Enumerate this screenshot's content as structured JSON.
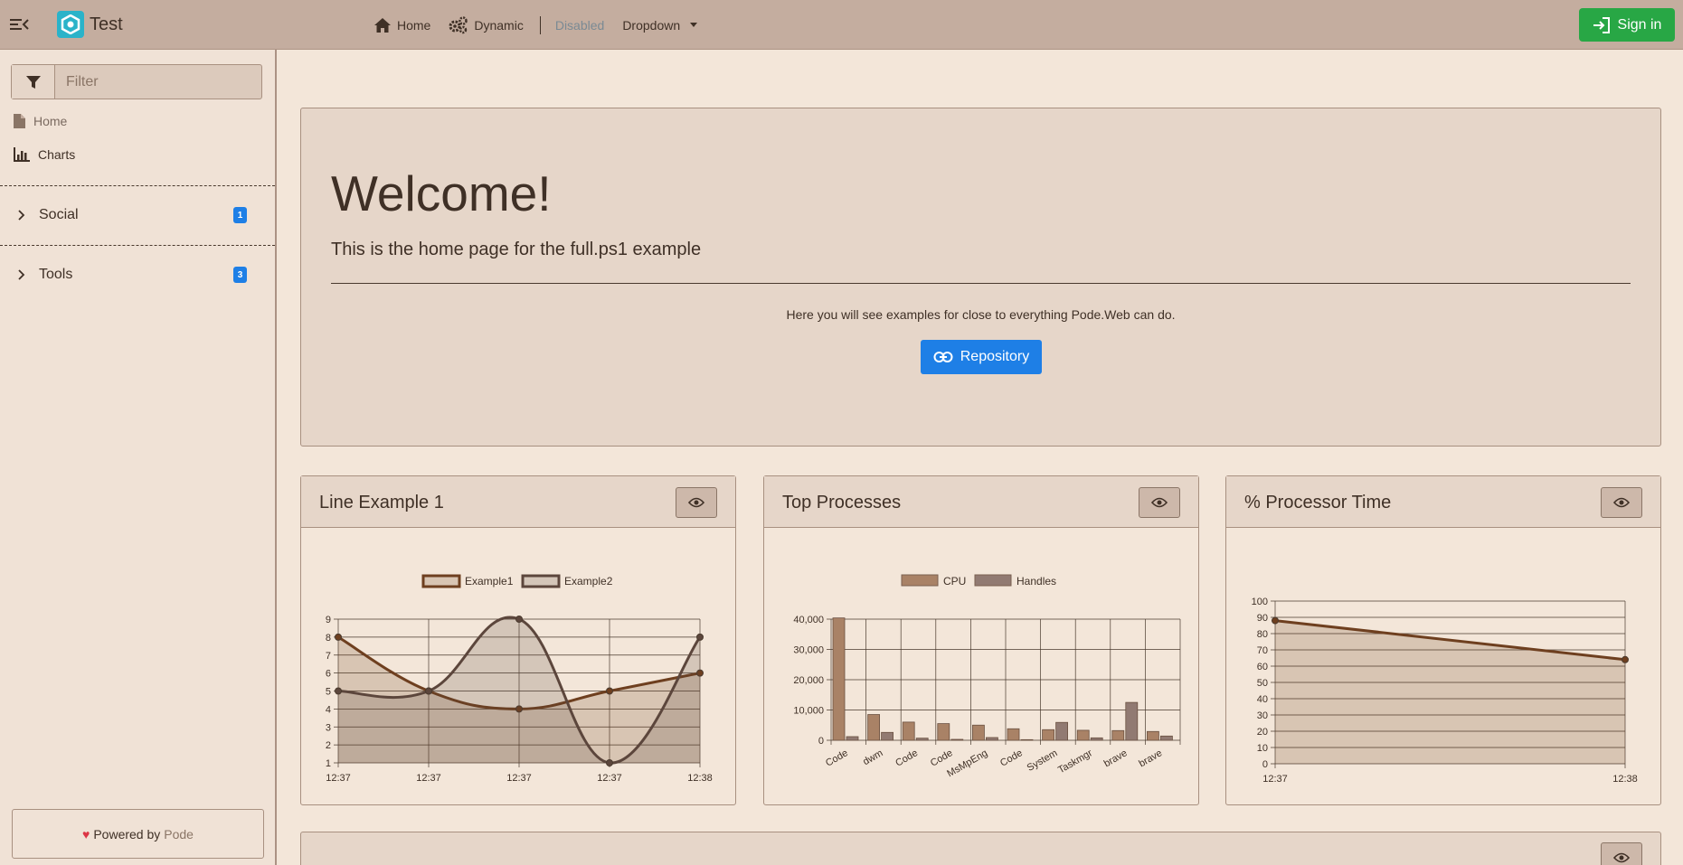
{
  "app": {
    "title": "Test",
    "brand_color": "#2ab3c9"
  },
  "nav": {
    "home": "Home",
    "dynamic": "Dynamic",
    "disabled": "Disabled",
    "dropdown": "Dropdown",
    "signin": "Sign in"
  },
  "sidebar": {
    "filter_placeholder": "Filter",
    "links": [
      {
        "label": "Home",
        "icon": "file-icon"
      },
      {
        "label": "Charts",
        "icon": "chart-bar-icon"
      }
    ],
    "groups": [
      {
        "label": "Social",
        "badge": "1"
      },
      {
        "label": "Tools",
        "badge": "3"
      }
    ],
    "powered_by": "Powered by",
    "powered_link": "Pode"
  },
  "hero": {
    "title": "Welcome!",
    "lead": "This is the home page for the full.ps1 example",
    "text": "Here you will see examples for close to everything Pode.Web can do.",
    "button": "Repository"
  },
  "cards": [
    {
      "title": "Line Example 1"
    },
    {
      "title": "Top Processes"
    },
    {
      "title": "% Processor Time"
    }
  ],
  "chart_data": [
    {
      "type": "line",
      "title": "Line Example 1",
      "x": [
        "12:37",
        "12:37",
        "12:37",
        "12:37",
        "12:38"
      ],
      "series": [
        {
          "name": "Example1",
          "values": [
            8,
            5,
            4,
            5,
            6
          ],
          "color": "#6e3f1f"
        },
        {
          "name": "Example2",
          "values": [
            5,
            5,
            9,
            1,
            8
          ],
          "color": "#5c463c"
        }
      ],
      "ylim": [
        1,
        9
      ],
      "yticks": [
        1,
        2,
        3,
        4,
        5,
        6,
        7,
        8,
        9
      ],
      "legend": "top",
      "grid": true
    },
    {
      "type": "bar",
      "title": "Top Processes",
      "categories": [
        "Code",
        "dwm",
        "Code",
        "Code",
        "MsMpEng",
        "Code",
        "System",
        "Taskmgr",
        "brave",
        "brave"
      ],
      "series": [
        {
          "name": "CPU",
          "values": [
            40500,
            8500,
            6000,
            5500,
            5000,
            3800,
            3500,
            3300,
            3200,
            2900
          ],
          "color": "#a98266"
        },
        {
          "name": "Handles",
          "values": [
            1200,
            2600,
            700,
            300,
            900,
            200,
            5900,
            800,
            12500,
            1400
          ],
          "color": "#917a72"
        }
      ],
      "ylim": [
        0,
        40000
      ],
      "yticks": [
        "0",
        "10,000",
        "20,000",
        "30,000",
        "40,000"
      ],
      "legend": "top",
      "grid": true
    },
    {
      "type": "area",
      "title": "% Processor Time",
      "x": [
        "12:37",
        "12:38"
      ],
      "series": [
        {
          "name": "",
          "values": [
            88,
            64
          ],
          "color": "#6e3f1f"
        }
      ],
      "ylim": [
        0,
        100
      ],
      "yticks": [
        0,
        10,
        20,
        30,
        40,
        50,
        60,
        70,
        80,
        90,
        100
      ],
      "legend": "none",
      "grid": true
    }
  ]
}
